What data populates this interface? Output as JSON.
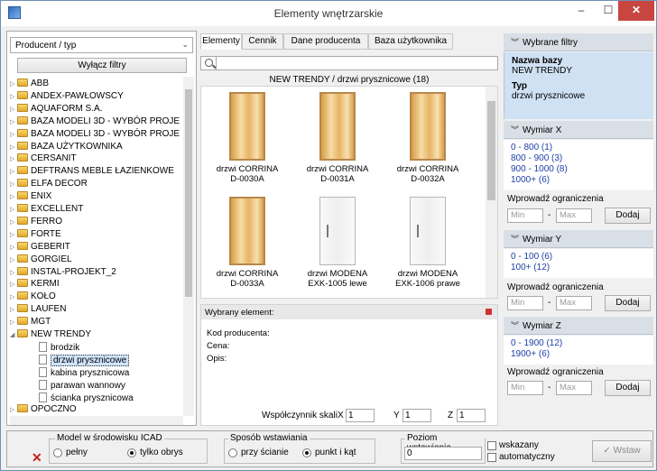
{
  "window": {
    "title": "Elementy wnętrzarskie",
    "min": "–",
    "max": "☐",
    "close": "✕"
  },
  "left": {
    "combo_value": "Producent / typ",
    "disable_filters": "Wyłącz filtry",
    "tree": [
      {
        "label": "ABB",
        "kind": "folder",
        "expand": "▷"
      },
      {
        "label": "ANDEX-PAWŁOWSCY",
        "kind": "folder",
        "expand": "▷"
      },
      {
        "label": "AQUAFORM S.A.",
        "kind": "folder",
        "expand": "▷"
      },
      {
        "label": "BAZA MODELI 3D - WYBÓR PROJE",
        "kind": "folder",
        "expand": "▷"
      },
      {
        "label": "BAZA MODELI 3D - WYBÓR PROJE",
        "kind": "folder",
        "expand": "▷"
      },
      {
        "label": "BAZA UŻYTKOWNIKA",
        "kind": "folder",
        "expand": "▷"
      },
      {
        "label": "CERSANIT",
        "kind": "folder",
        "expand": "▷"
      },
      {
        "label": "DEFTRANS MEBLE ŁAZIENKOWE",
        "kind": "folder",
        "expand": "▷"
      },
      {
        "label": "ELFA DECOR",
        "kind": "folder",
        "expand": "▷"
      },
      {
        "label": "ENIX",
        "kind": "folder",
        "expand": "▷"
      },
      {
        "label": "EXCELLENT",
        "kind": "folder",
        "expand": "▷"
      },
      {
        "label": "FERRO",
        "kind": "folder",
        "expand": "▷"
      },
      {
        "label": "FORTE",
        "kind": "folder",
        "expand": "▷"
      },
      {
        "label": "GEBERIT",
        "kind": "folder",
        "expand": "▷"
      },
      {
        "label": "GORGIEL",
        "kind": "folder",
        "expand": "▷"
      },
      {
        "label": "INSTAL-PROJEKT_2",
        "kind": "folder",
        "expand": "▷"
      },
      {
        "label": "KERMI",
        "kind": "folder",
        "expand": "▷"
      },
      {
        "label": "KOŁO",
        "kind": "folder",
        "expand": "▷"
      },
      {
        "label": "LAUFEN",
        "kind": "folder",
        "expand": "▷"
      },
      {
        "label": "MGT",
        "kind": "folder",
        "expand": "▷"
      },
      {
        "label": "NEW TRENDY",
        "kind": "folder",
        "expand": "◢"
      },
      {
        "label": "brodzik",
        "kind": "doc",
        "expand": ""
      },
      {
        "label": "drzwi prysznicowe",
        "kind": "doc",
        "expand": "",
        "selected": true
      },
      {
        "label": "kabina prysznicowa",
        "kind": "doc",
        "expand": ""
      },
      {
        "label": "parawan wannowy",
        "kind": "doc",
        "expand": ""
      },
      {
        "label": "ścianka prysznicowa",
        "kind": "doc",
        "expand": ""
      },
      {
        "label": "OPOCZNO",
        "kind": "folder",
        "expand": "▷"
      }
    ]
  },
  "center": {
    "tabs": [
      "Elementy",
      "Cennik",
      "Dane producenta",
      "Baza użytkownika"
    ],
    "active_tab": "Elementy",
    "search_value": "",
    "group_title": "NEW TRENDY / drzwi prysznicowe (18)",
    "products": [
      {
        "line1": "drzwi CORRINA",
        "line2": "D-0030A",
        "style": "gold"
      },
      {
        "line1": "drzwi CORRINA",
        "line2": "D-0031A",
        "style": "gold"
      },
      {
        "line1": "drzwi CORRINA",
        "line2": "D-0032A",
        "style": "gold"
      },
      {
        "line1": "drzwi CORRINA",
        "line2": "D-0033A",
        "style": "gold"
      },
      {
        "line1": "drzwi MODENA",
        "line2": "EXK-1005 lewe",
        "style": "clear"
      },
      {
        "line1": "drzwi MODENA",
        "line2": "EXK-1006 prawe",
        "style": "clear"
      }
    ],
    "selected": {
      "header": "Wybrany element:",
      "code": "Kod producenta:",
      "price": "Cena:",
      "desc": "Opis:"
    },
    "scale": {
      "label": "Współczynnik skali",
      "x_label": "X",
      "x": "1",
      "y_label": "Y",
      "y": "1",
      "z_label": "Z",
      "z": "1"
    }
  },
  "right": {
    "filters_header": "Wybrane filtry",
    "db_label": "Nazwa bazy",
    "db_value": "NEW TRENDY",
    "type_label": "Typ",
    "type_value": "drzwi prysznicowe",
    "constraint_label": "Wprowadź ograniczenia",
    "min_placeholder": "Min",
    "max_placeholder": "Max",
    "add_label": "Dodaj",
    "dash": "-",
    "dim_x": {
      "title": "Wymiar X",
      "values": [
        "0 - 800  (1)",
        "800 - 900  (3)",
        "900 - 1000  (8)",
        "1000+  (6)"
      ]
    },
    "dim_y": {
      "title": "Wymiar Y",
      "values": [
        "0 - 100  (6)",
        "100+  (12)"
      ]
    },
    "dim_z": {
      "title": "Wymiar Z",
      "values": [
        "0 - 1900  (12)",
        "1900+  (6)"
      ]
    }
  },
  "bottom": {
    "model_legend": "Model w środowisku ICAD",
    "model_full": "pełny",
    "model_outline": "tylko obrys",
    "insert_legend": "Sposób wstawiania",
    "insert_wall": "przy ścianie",
    "insert_point": "punkt i kąt",
    "level_legend": "Poziom wstawienia",
    "level_value": "0",
    "indicated_line1": "wskazany",
    "indicated_line2": "automatyczny",
    "insert_button": "✓ Wstaw"
  }
}
